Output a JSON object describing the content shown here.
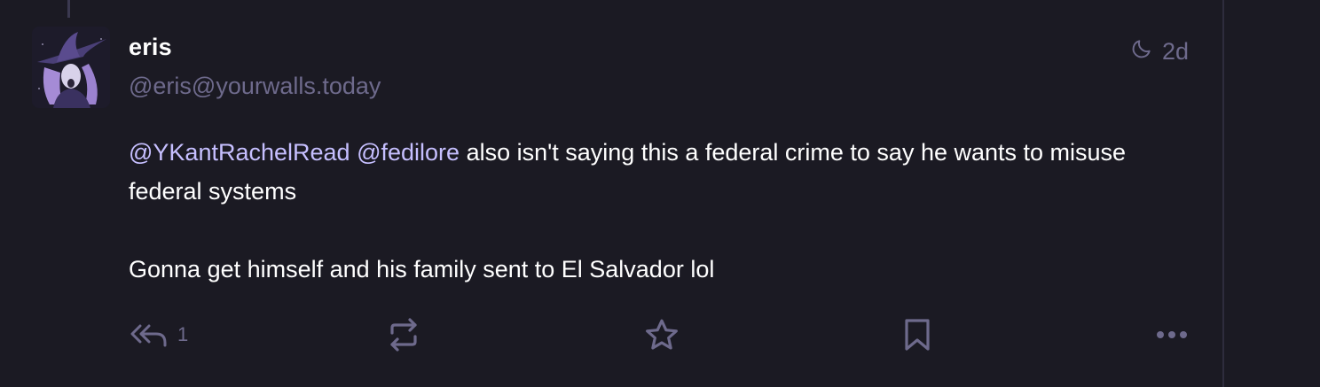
{
  "status": {
    "display_name": "eris",
    "account": "@eris@yourwalls.today",
    "relative_time": "2d",
    "visibility_icon": "moon-icon",
    "content": {
      "line1": {
        "mention1": "@YKantRachelRead",
        "mention2": "@fedilore",
        "text": "also isn't saying this a federal crime to say he wants to misuse federal systems"
      },
      "line2": "Gonna get himself and his family sent to El Salvador lol"
    },
    "actions": {
      "reply_count": "1",
      "reply_icon": "reply-all-icon",
      "boost_icon": "boost-icon",
      "favourite_icon": "star-icon",
      "bookmark_icon": "bookmark-icon",
      "more_icon": "more-horizontal-icon"
    }
  },
  "colors": {
    "background": "#1b1a23",
    "text": "#ffffff",
    "muted": "#6e6a8c",
    "mention": "#c6bfff"
  }
}
